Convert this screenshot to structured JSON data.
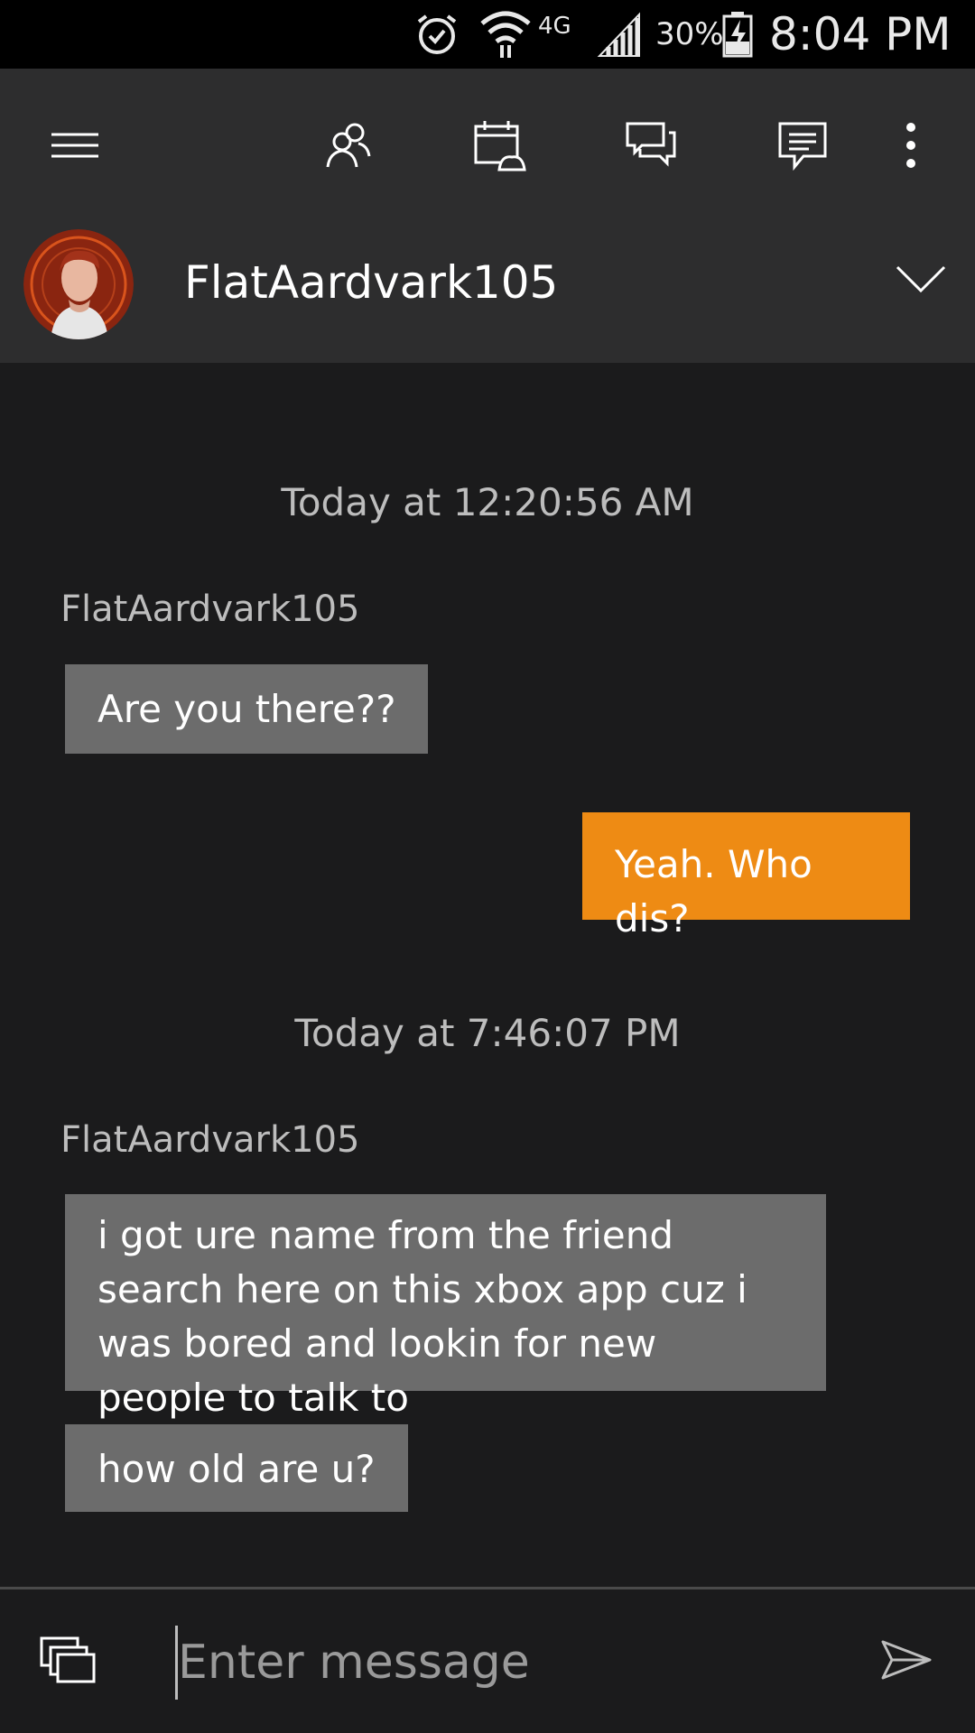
{
  "status_bar": {
    "network": "4G",
    "battery": "30%",
    "time": "8:04 PM"
  },
  "toolbar": {
    "icons": [
      "hamburger-menu-icon",
      "friends-icon",
      "calendar-controller-icon",
      "conversations-icon",
      "message-icon",
      "more-options-icon"
    ]
  },
  "conversation": {
    "name": "FlatAardvark105"
  },
  "messages": [
    {
      "timestamp": "Today at 12:20:56 AM"
    },
    {
      "sender": "FlatAardvark105",
      "text": "Are you there??"
    },
    {
      "text": "Yeah. Who dis?"
    },
    {
      "timestamp": "Today at 7:46:07 PM"
    },
    {
      "sender": "FlatAardvark105",
      "text": "i got ure name from the friend search here on this xbox app cuz i was bored and lookin for new people to talk to"
    },
    {
      "text": "how old are u?"
    }
  ],
  "composer": {
    "placeholder": "Enter message"
  },
  "colors": {
    "outgoing_bubble": "#ee8b14",
    "incoming_bubble": "#6c6c6c",
    "background": "#1b1b1c",
    "toolbar": "#2d2d2e"
  }
}
